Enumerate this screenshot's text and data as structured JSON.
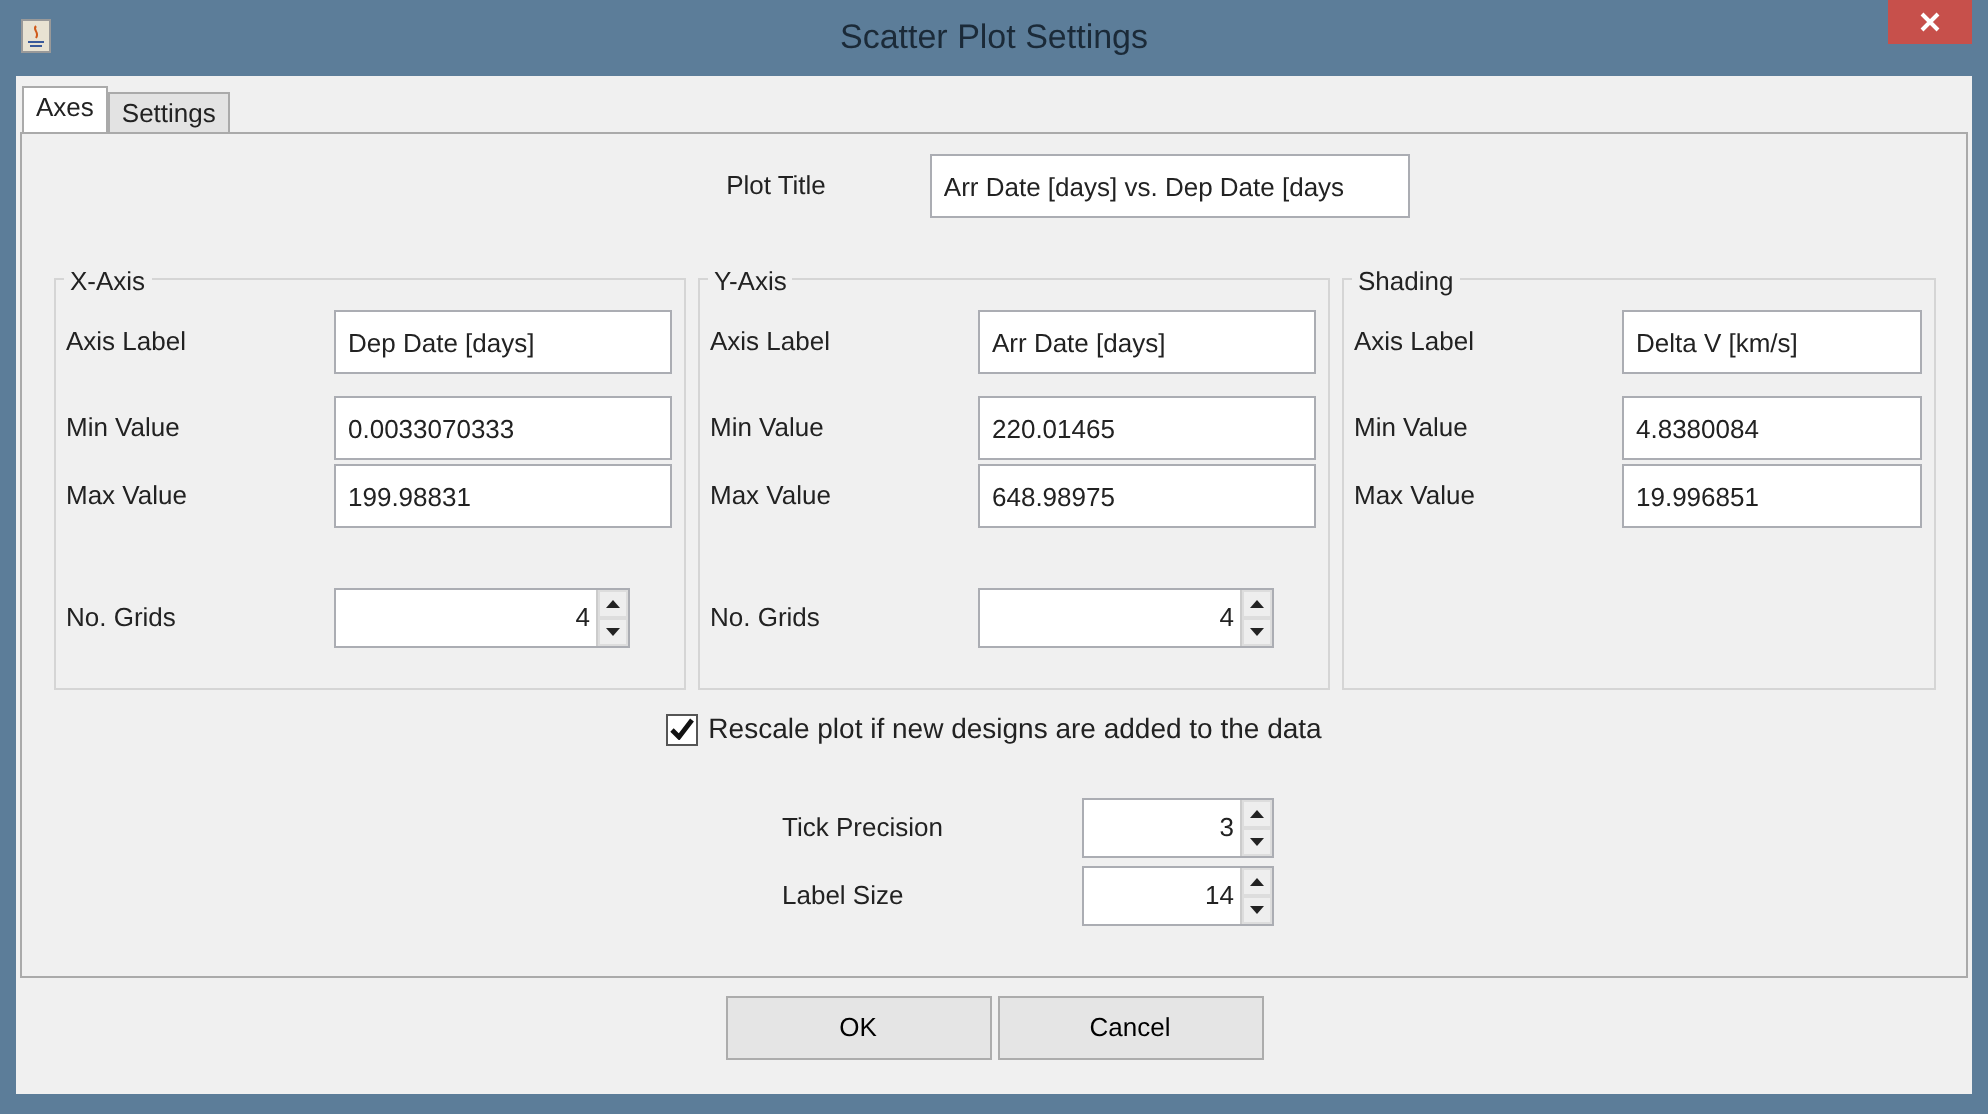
{
  "window": {
    "title": "Scatter Plot Settings"
  },
  "tabs": [
    {
      "label": "Axes",
      "selected": true
    },
    {
      "label": "Settings",
      "selected": false
    }
  ],
  "plot_title": {
    "label": "Plot Title",
    "value": "Arr Date [days] vs. Dep Date [days"
  },
  "groups": [
    {
      "title": "X-Axis",
      "fields": [
        {
          "kind": "text",
          "label": "Axis Label",
          "value": "Dep Date [days]"
        },
        {
          "kind": "text",
          "label": "Min Value",
          "value": "0.0033070333"
        },
        {
          "kind": "text",
          "label": "Max Value",
          "value": "199.98831"
        },
        {
          "kind": "spinner",
          "label": "No. Grids",
          "value": "4"
        }
      ]
    },
    {
      "title": "Y-Axis",
      "fields": [
        {
          "kind": "text",
          "label": "Axis Label",
          "value": "Arr Date [days]"
        },
        {
          "kind": "text",
          "label": "Min Value",
          "value": "220.01465"
        },
        {
          "kind": "text",
          "label": "Max Value",
          "value": "648.98975"
        },
        {
          "kind": "spinner",
          "label": "No. Grids",
          "value": "4"
        }
      ]
    },
    {
      "title": "Shading",
      "fields": [
        {
          "kind": "text",
          "label": "Axis Label",
          "value": "Delta V [km/s]"
        },
        {
          "kind": "text",
          "label": "Min Value",
          "value": "4.8380084"
        },
        {
          "kind": "text",
          "label": "Max Value",
          "value": "19.996851"
        }
      ]
    }
  ],
  "rescale": {
    "label": "Rescale plot if new designs are added to the data",
    "checked": true
  },
  "spinners": [
    {
      "label": "Tick Precision",
      "value": "3"
    },
    {
      "label": "Label Size",
      "value": "14"
    }
  ],
  "buttons": [
    "OK",
    "Cancel"
  ]
}
